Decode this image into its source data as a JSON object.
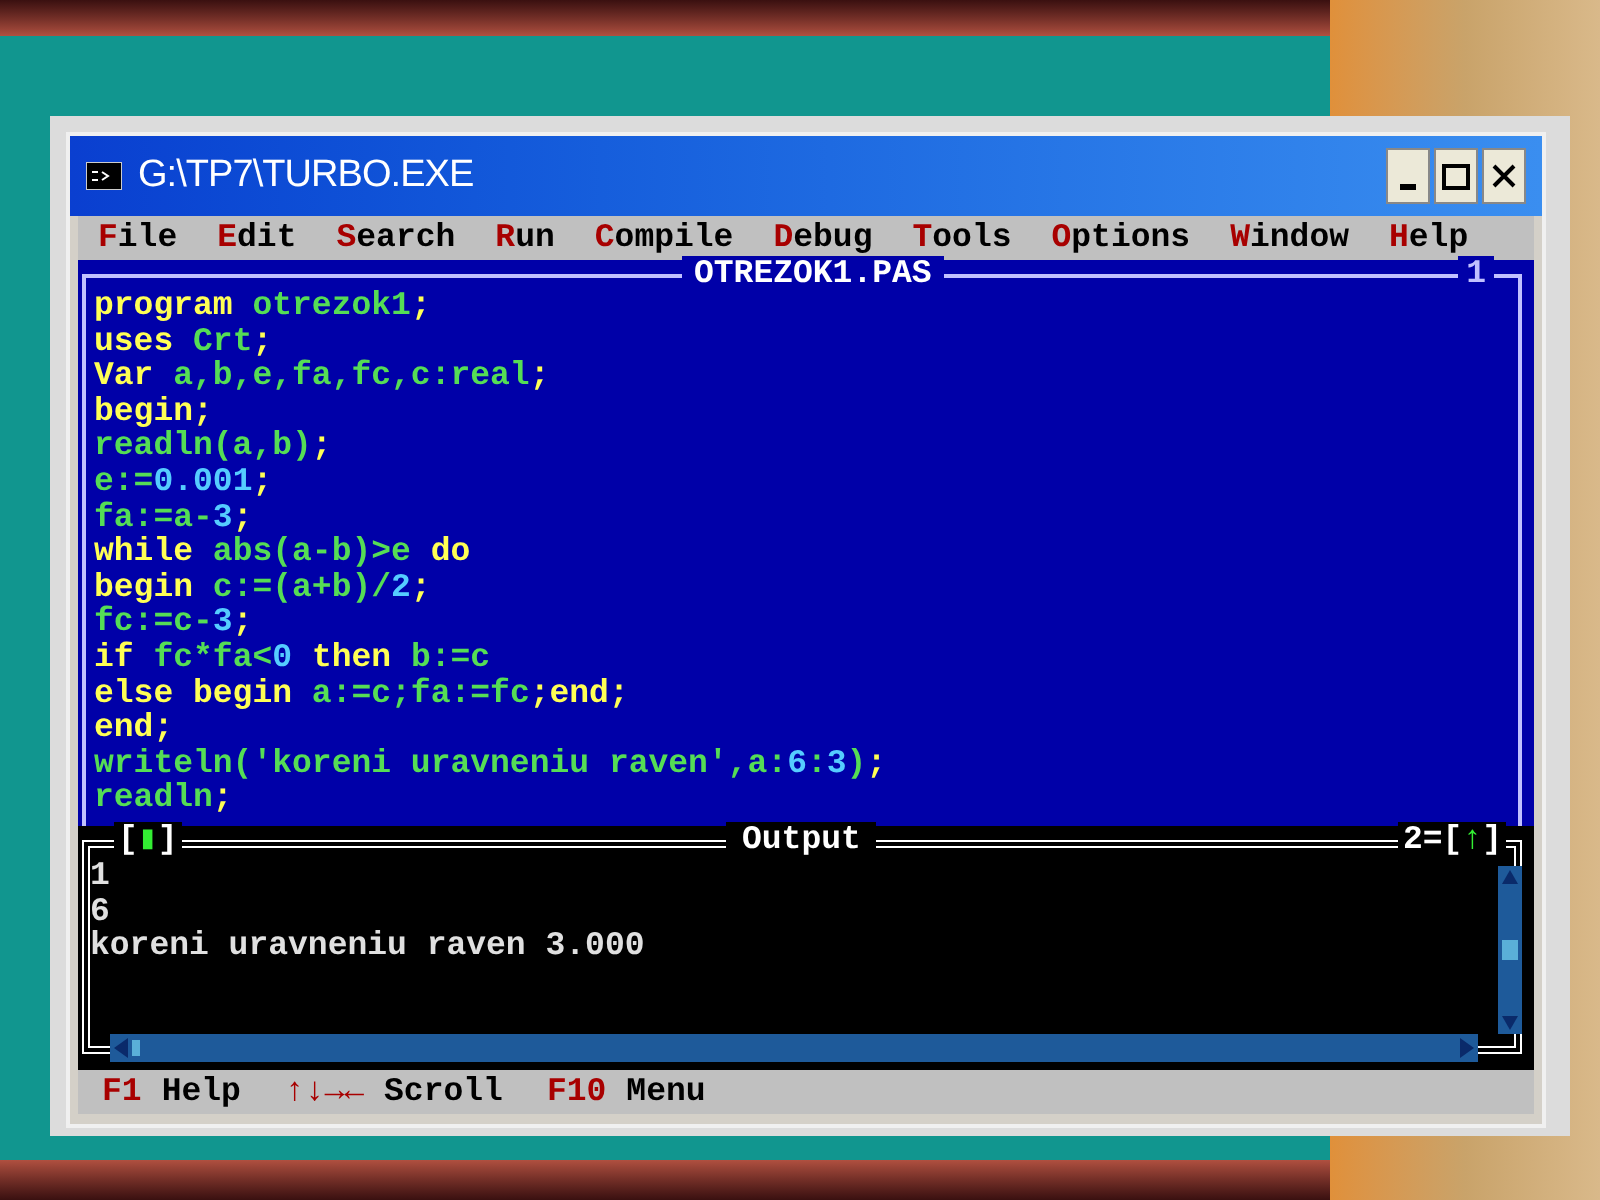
{
  "window": {
    "title": "G:\\TP7\\TURBO.EXE"
  },
  "menu": [
    "File",
    "Edit",
    "Search",
    "Run",
    "Compile",
    "Debug",
    "Tools",
    "Options",
    "Window",
    "Help"
  ],
  "editor": {
    "title": "OTREZOK1.PAS",
    "number": "1",
    "lines": [
      [
        {
          "kind": "reserved",
          "text": "program "
        },
        {
          "kind": "identifier",
          "text": "otrezok1"
        },
        {
          "kind": "reserved",
          "text": ";"
        }
      ],
      [
        {
          "kind": "reserved",
          "text": "uses "
        },
        {
          "kind": "identifier",
          "text": "Crt"
        },
        {
          "kind": "reserved",
          "text": ";"
        }
      ],
      [
        {
          "kind": "reserved",
          "text": "Var "
        },
        {
          "kind": "identifier",
          "text": "a,b,e,fa,fc,c:real"
        },
        {
          "kind": "reserved",
          "text": ";"
        }
      ],
      [
        {
          "kind": "reserved",
          "text": "begin;"
        }
      ],
      [
        {
          "kind": "identifier",
          "text": "readln(a,b)"
        },
        {
          "kind": "reserved",
          "text": ";"
        }
      ],
      [
        {
          "kind": "identifier",
          "text": "e:="
        },
        {
          "kind": "number",
          "text": "0.001"
        },
        {
          "kind": "reserved",
          "text": ";"
        }
      ],
      [
        {
          "kind": "identifier",
          "text": "fa:=a-"
        },
        {
          "kind": "number",
          "text": "3"
        },
        {
          "kind": "reserved",
          "text": ";"
        }
      ],
      [
        {
          "kind": "reserved",
          "text": "while "
        },
        {
          "kind": "identifier",
          "text": "abs(a-b)>e "
        },
        {
          "kind": "reserved",
          "text": "do"
        }
      ],
      [
        {
          "kind": "reserved",
          "text": "begin "
        },
        {
          "kind": "identifier",
          "text": "c:=(a+b)/"
        },
        {
          "kind": "number",
          "text": "2"
        },
        {
          "kind": "reserved",
          "text": ";"
        }
      ],
      [
        {
          "kind": "identifier",
          "text": "fc:=c-"
        },
        {
          "kind": "number",
          "text": "3"
        },
        {
          "kind": "reserved",
          "text": ";"
        }
      ],
      [
        {
          "kind": "reserved",
          "text": "if "
        },
        {
          "kind": "identifier",
          "text": "fc*fa<"
        },
        {
          "kind": "number",
          "text": "0"
        },
        {
          "kind": "reserved",
          "text": " then "
        },
        {
          "kind": "identifier",
          "text": "b:=c"
        }
      ],
      [
        {
          "kind": "reserved",
          "text": "else begin "
        },
        {
          "kind": "identifier",
          "text": "a:=c;fa:=fc"
        },
        {
          "kind": "reserved",
          "text": ";end;"
        }
      ],
      [
        {
          "kind": "reserved",
          "text": "end;"
        }
      ],
      [
        {
          "kind": "identifier",
          "text": "writeln('koreni uravneniu raven',a:"
        },
        {
          "kind": "number",
          "text": "6"
        },
        {
          "kind": "identifier",
          "text": ":"
        },
        {
          "kind": "number",
          "text": "3"
        },
        {
          "kind": "identifier",
          "text": ")"
        },
        {
          "kind": "reserved",
          "text": ";"
        }
      ],
      [
        {
          "kind": "identifier",
          "text": "readln"
        },
        {
          "kind": "reserved",
          "text": ";"
        }
      ]
    ]
  },
  "output": {
    "title": "Output",
    "close_box": "[▮]",
    "number": "2=",
    "zoom_box": "[↑]",
    "lines": [
      "1",
      "6",
      "koreni uravneniu raven 3.000"
    ]
  },
  "status_bar": [
    {
      "key": "F1",
      "label": "Help"
    },
    {
      "key": "↑↓→←",
      "label": "Scroll"
    },
    {
      "key": "F10",
      "label": "Menu"
    }
  ]
}
